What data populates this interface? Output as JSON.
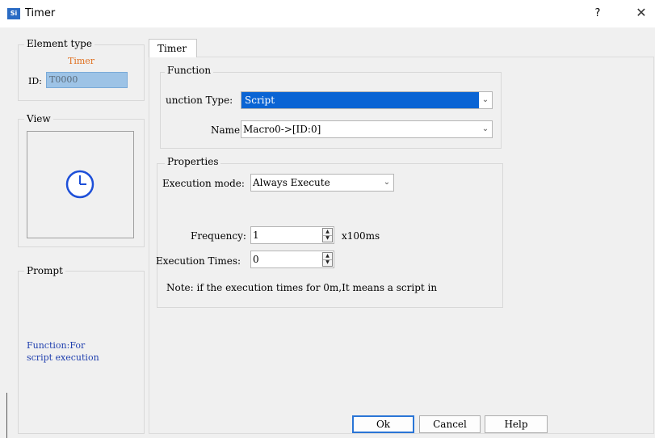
{
  "window": {
    "title": "Timer",
    "app_icon_text": "Si",
    "help_glyph": "?",
    "close_glyph": "✕"
  },
  "left": {
    "element_type_label": "Element type",
    "element_type_value": "Timer",
    "id_label": "ID:",
    "id_value": "T0000",
    "view_label": "View",
    "prompt_label": "Prompt",
    "prompt_text_line1": "Function:For",
    "prompt_text_line2": "script execution"
  },
  "tab": {
    "label": "Timer"
  },
  "function_group": {
    "label": "Function",
    "type_label": "unction Type:",
    "type_value": "Script",
    "name_label": "Name:",
    "name_value": "Macro0->[ID:0]"
  },
  "properties_group": {
    "label": "Properties",
    "mode_label": "Execution mode:",
    "mode_value": "Always Execute",
    "frequency_label": "Frequency:",
    "frequency_value": "1",
    "frequency_unit": "x100ms",
    "times_label": "Execution Times:",
    "times_value": "0",
    "note": "Note: if the execution times for 0m,It means a script in"
  },
  "buttons": {
    "ok": "Ok",
    "cancel": "Cancel",
    "help": "Help"
  },
  "icons": {
    "clock": "clock-icon",
    "chevron": "chevron-down-icon",
    "spin_up": "▲",
    "spin_down": "▼"
  },
  "colors": {
    "accent": "#0a64d4",
    "element_type": "#e07020",
    "prompt_text": "#1f3fae",
    "clock": "#1d4fd8"
  }
}
